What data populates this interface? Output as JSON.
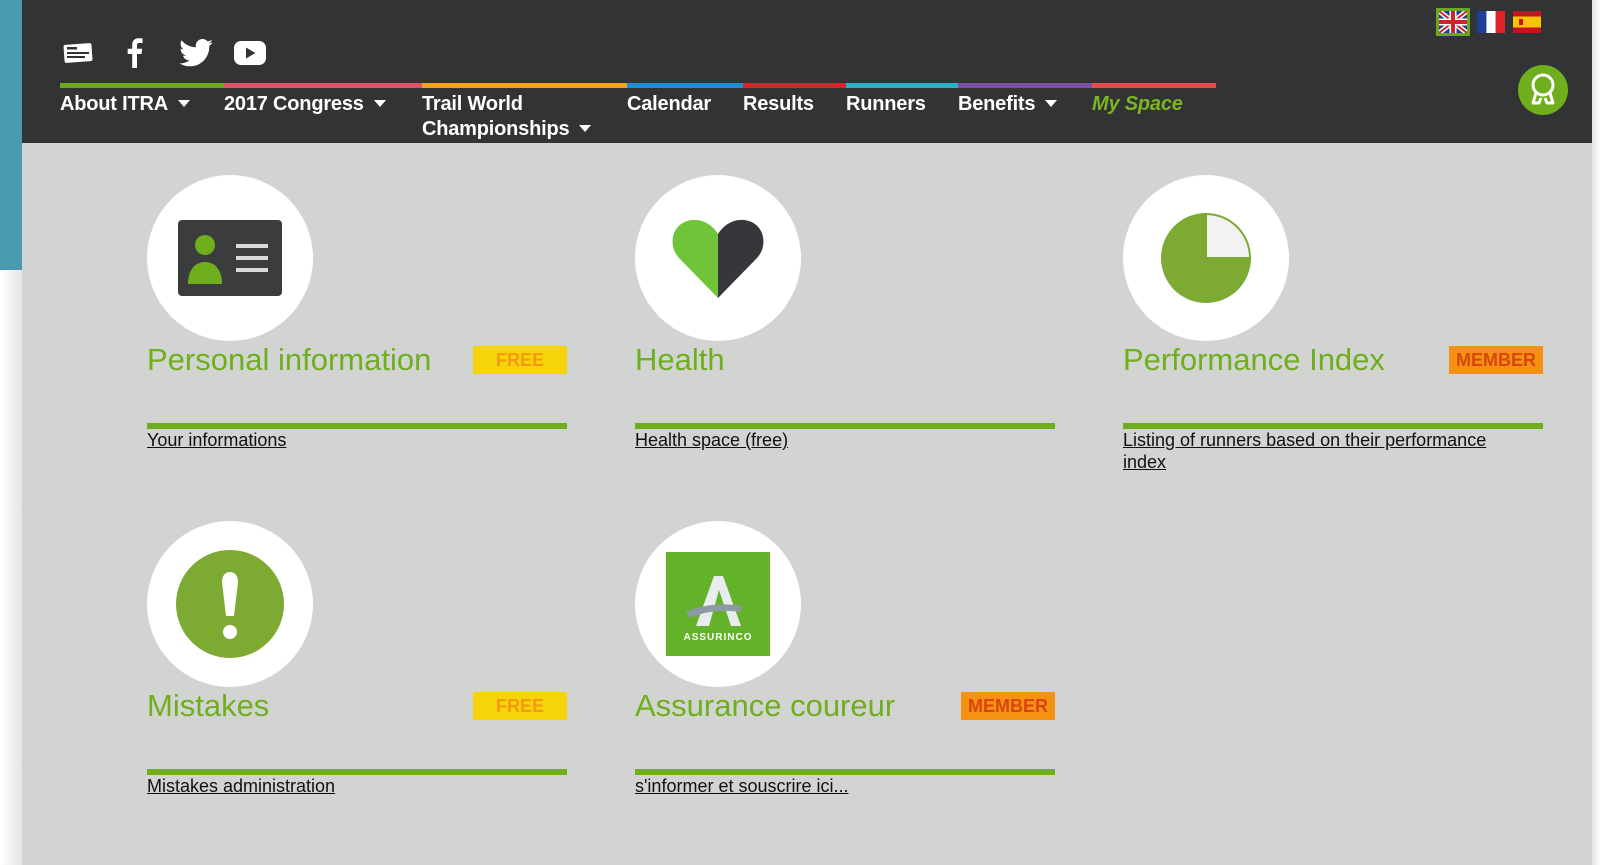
{
  "social": [
    {
      "name": "newsletter-icon"
    },
    {
      "name": "facebook-icon"
    },
    {
      "name": "twitter-icon"
    },
    {
      "name": "youtube-icon"
    }
  ],
  "languages": [
    {
      "name": "flag-uk-icon",
      "lang": "English"
    },
    {
      "name": "flag-france-icon",
      "lang": "Français"
    },
    {
      "name": "flag-spain-icon",
      "lang": "Español"
    }
  ],
  "nav": {
    "items": [
      {
        "label": "About ITRA",
        "dropdown": true,
        "color": "#6aa91d"
      },
      {
        "label": "2017 Congress",
        "dropdown": true,
        "color": "#e0526c"
      },
      {
        "label_line1": "Trail World",
        "label_line2": "Championships",
        "dropdown": true,
        "color": "#f4a21a"
      },
      {
        "label": "Calendar",
        "dropdown": false,
        "color": "#1e8ed6"
      },
      {
        "label": "Results",
        "dropdown": false,
        "color": "#d8242a"
      },
      {
        "label": "Runners",
        "dropdown": false,
        "color": "#2bb2c4"
      },
      {
        "label": "Benefits",
        "dropdown": true,
        "color": "#7a4fa2"
      },
      {
        "label": "My Space",
        "dropdown": false,
        "color": "#e84b4b",
        "active": true
      }
    ]
  },
  "cards": [
    {
      "title": "Personal information",
      "badge": "FREE",
      "badge_type": "free",
      "link": "Your informations ",
      "icon": "id-card-icon"
    },
    {
      "title": "Health",
      "badge": "",
      "badge_type": "",
      "link": "Health space (free)",
      "icon": "heart-icon"
    },
    {
      "title": "Performance Index",
      "badge": "MEMBER",
      "badge_type": "member",
      "link": "Listing of runners based on their performance index",
      "icon": "pie-chart-icon"
    },
    {
      "title": "Mistakes",
      "badge": "FREE",
      "badge_type": "free",
      "link": "Mistakes administration",
      "icon": "exclamation-icon"
    },
    {
      "title": "Assurance coureur",
      "badge": "MEMBER",
      "badge_type": "member",
      "link": "s'informer et souscrire ici...",
      "icon": "assurinco-logo",
      "logo_text": "ASSURINCO"
    }
  ],
  "colors": {
    "brand_green": "#6fae1d",
    "header_bg": "#313335",
    "content_bg": "#d2d4d1",
    "free_badge": "#f7d40a",
    "member_badge": "#f59212"
  }
}
